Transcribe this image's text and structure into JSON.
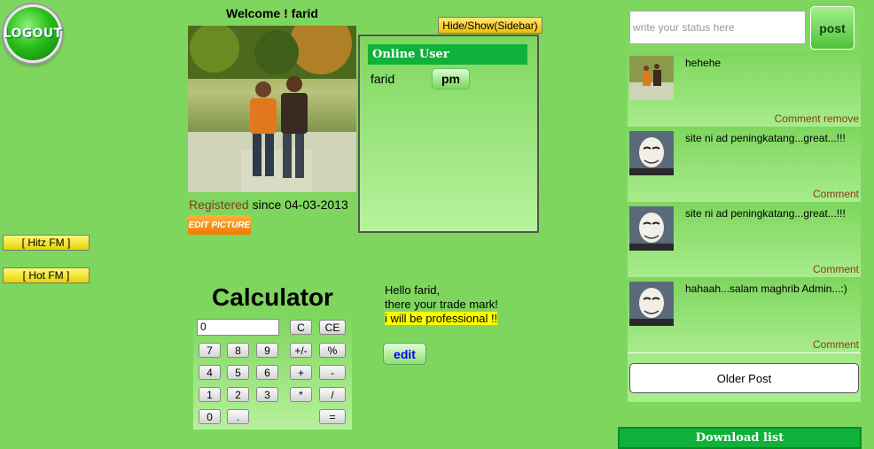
{
  "logout": {
    "label": "LOGOUT"
  },
  "radio": [
    {
      "label": "[ Hitz FM ]"
    },
    {
      "label": "[ Hot FM ]"
    }
  ],
  "profile": {
    "welcome": "Welcome ! farid",
    "registered_label": "Registered",
    "registered_since": " since 04-03-2013",
    "edit_picture_label": "EDIT PICTURE"
  },
  "sidebar_toggle": {
    "label": "Hide/Show(Sidebar)"
  },
  "online": {
    "header": "Online User",
    "users": [
      {
        "name": "farid",
        "pm_label": "pm"
      }
    ]
  },
  "calculator": {
    "title": "Calculator",
    "display": "0",
    "keys": {
      "c": "C",
      "ce": "CE",
      "k7": "7",
      "k8": "8",
      "k9": "9",
      "pm": "+/-",
      "pct": "%",
      "k4": "4",
      "k5": "5",
      "k6": "6",
      "plus": "+",
      "minus": "-",
      "k1": "1",
      "k2": "2",
      "k3": "3",
      "mul": "*",
      "div": "/",
      "k0": "0",
      "dot": ".",
      "eq": "="
    }
  },
  "motto": {
    "line1": "Hello farid,",
    "line2": "there your trade mark!",
    "highlight": "i will be professional !!",
    "edit_label": "edit"
  },
  "status": {
    "placeholder": "write your status here",
    "post_label": "post"
  },
  "posts": [
    {
      "text": "hehehe",
      "action": "Comment remove"
    },
    {
      "text": "site ni ad peningkatang...great...!!!",
      "action": "Comment"
    },
    {
      "text": "site ni ad peningkatang...great...!!!",
      "action": "Comment"
    },
    {
      "text": "hahaah...salam maghrib Admin...:)",
      "action": "Comment"
    }
  ],
  "older_post_label": "Older Post",
  "download_list_label": "Download list"
}
